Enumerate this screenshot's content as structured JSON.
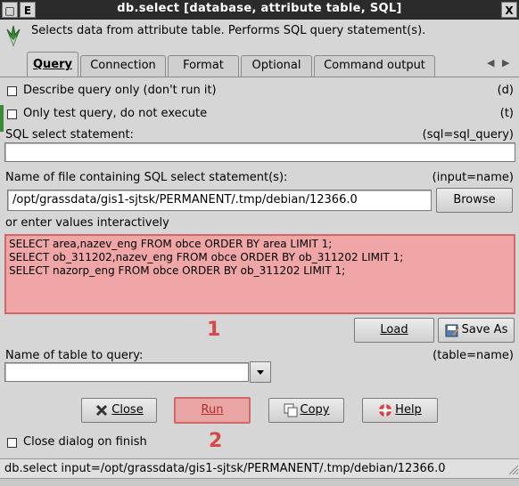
{
  "window": {
    "title": "db.select [database, attribute table, SQL]",
    "btn_left1": "□",
    "btn_left2": "E",
    "btn_right": "X"
  },
  "header": {
    "description": "Selects data from attribute table. Performs SQL query statement(s)."
  },
  "tabs": [
    {
      "label": "Query",
      "active": true
    },
    {
      "label": "Connection",
      "active": false
    },
    {
      "label": "Format",
      "active": false
    },
    {
      "label": "Optional",
      "active": false
    },
    {
      "label": "Command output",
      "active": false
    }
  ],
  "options": {
    "describe": {
      "label": "Describe query only (don't run it)",
      "flag": "(d)",
      "checked": false
    },
    "test": {
      "label": "Only test query, do not execute",
      "flag": "(t)",
      "checked": false
    }
  },
  "sql": {
    "label": "SQL select statement:",
    "param": "(sql=sql_query)",
    "value": ""
  },
  "input_file": {
    "label": "Name of file containing SQL select statement(s):",
    "param": "(input=name)",
    "value": "/opt/grassdata/gis1-sjtsk/PERMANENT/.tmp/debian/12366.0",
    "browse_label": "Browse"
  },
  "interactive": {
    "label": "or enter values interactively",
    "lines": [
      "SELECT area,nazev_eng FROM obce ORDER BY area LIMIT 1;",
      "SELECT ob_311202,nazev_eng FROM obce ORDER BY ob_311202 LIMIT 1;",
      "SELECT nazorp_eng FROM obce ORDER BY ob_311202 LIMIT 1;"
    ],
    "load_label": "Load",
    "save_as_label": "Save As"
  },
  "table": {
    "label": "Name of table to query:",
    "param": "(table=name)",
    "value": ""
  },
  "actions": {
    "close_label": "Close",
    "run_label": "Run",
    "copy_label": "Copy",
    "help_label": "Help"
  },
  "close_on_finish": {
    "label": "Close dialog on finish",
    "checked": false
  },
  "markers": {
    "one": "1",
    "two": "2"
  },
  "status": "db.select input=/opt/grassdata/gis1-sjtsk/PERMANENT/.tmp/debian/12366.0",
  "colors": {
    "highlight_fill": "#f0a6a6",
    "highlight_border": "#d06868",
    "marker": "#d84848",
    "titlebar": "#2b2b2b"
  }
}
